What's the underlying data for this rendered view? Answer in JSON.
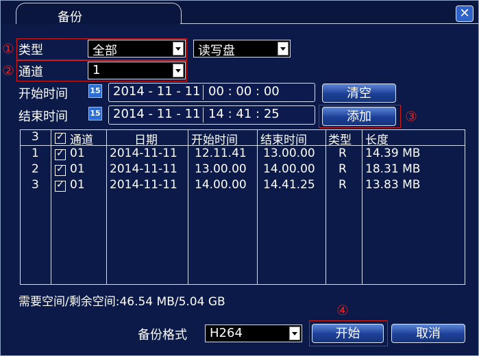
{
  "window": {
    "title": "备份",
    "close_label": "✕"
  },
  "form": {
    "type_label": "类型",
    "type_value": "全部",
    "disk_value": "读写盘",
    "channel_label": "通道",
    "channel_value": "1",
    "start_label": "开始时间",
    "start_date": "2014 - 11 - 11",
    "start_time": "00 : 00 : 00",
    "end_label": "结束时间",
    "end_date": "2014 - 11 - 11",
    "end_time": "14 : 41 : 25",
    "calendar_icon_text": "15",
    "clear_button": "清空",
    "add_button": "添加"
  },
  "annotations": {
    "n1": "①",
    "n2": "②",
    "n3": "③",
    "n4": "④"
  },
  "table": {
    "headers": {
      "count": "3",
      "channel": "通道",
      "date": "日期",
      "start": "开始时间",
      "end": "结束时间",
      "type": "类型",
      "size": "长度"
    },
    "rows": [
      {
        "no": "1",
        "channel": "01",
        "date": "2014-11-11",
        "start": "12.11.41",
        "end": "13.00.00",
        "type": "R",
        "size": "14.39 MB"
      },
      {
        "no": "2",
        "channel": "01",
        "date": "2014-11-11",
        "start": "13.00.00",
        "end": "14.00.00",
        "type": "R",
        "size": "18.31 MB"
      },
      {
        "no": "3",
        "channel": "01",
        "date": "2014-11-11",
        "start": "14.00.00",
        "end": "14.41.25",
        "type": "R",
        "size": "13.83 MB"
      }
    ]
  },
  "space_info": "需要空间/剩余空间:46.54 MB/5.04 GB",
  "footer": {
    "format_label": "备份格式",
    "format_value": "H264",
    "start_button": "开始",
    "cancel_button": "取消"
  },
  "colors": {
    "background": "#0b1a48",
    "highlight_red": "#d21a1a",
    "button_blue": "#1d3f97"
  }
}
